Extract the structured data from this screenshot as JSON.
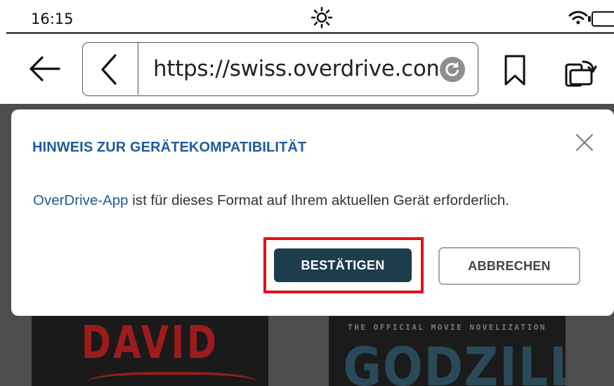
{
  "status_bar": {
    "time": "16:15",
    "icons": [
      "brightness-icon",
      "wifi-icon",
      "battery-icon"
    ]
  },
  "browser": {
    "url": "https://swiss.overdrive.com/se",
    "icons": [
      "back-arrow-icon",
      "chevron-left-icon",
      "reload-icon",
      "bookmark-icon",
      "rotate-screen-icon"
    ]
  },
  "background_books": [
    {
      "title_text": "DAVID",
      "subtitle_partial": ""
    },
    {
      "tagline": "THE OFFICIAL MOVIE NOVELIZATION",
      "title_text": "GODZILLA"
    }
  ],
  "dialog": {
    "title": "HINWEIS ZUR GERÄTEKOMPATIBILITÄT",
    "message_link": "OverDrive-App",
    "message_rest": " ist für dieses Format auf Ihrem aktuellen Gerät erforderlich.",
    "confirm_label": "BESTÄTIGEN",
    "cancel_label": "ABBRECHEN",
    "close_icon": "close-icon"
  },
  "colors": {
    "dialog_title": "#1f5c9a",
    "confirm_button": "#1e3d4c",
    "highlight_border": "#e4101c",
    "overlay": "#4d4d4d"
  }
}
